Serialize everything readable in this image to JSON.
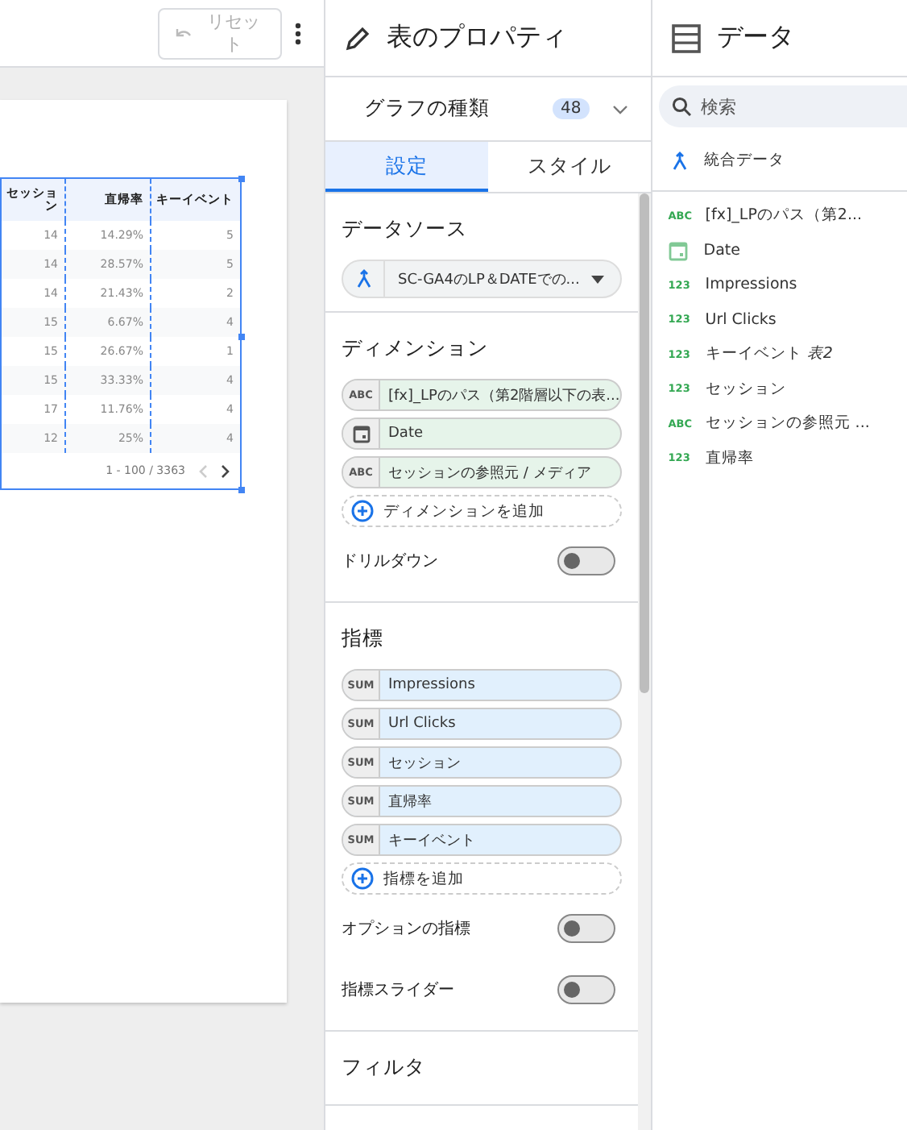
{
  "toolbar": {
    "reset_label": "リセット"
  },
  "table": {
    "columns": [
      "セッション",
      "直帰率",
      "キーイベント"
    ],
    "rows": [
      [
        "14",
        "14.29%",
        "5"
      ],
      [
        "14",
        "28.57%",
        "5"
      ],
      [
        "14",
        "21.43%",
        "2"
      ],
      [
        "15",
        "6.67%",
        "4"
      ],
      [
        "15",
        "26.67%",
        "1"
      ],
      [
        "15",
        "33.33%",
        "4"
      ],
      [
        "17",
        "11.76%",
        "4"
      ],
      [
        "12",
        "25%",
        "4"
      ]
    ],
    "pagination": "1 - 100 / 3363",
    "prev_disabled": true,
    "next_disabled": false
  },
  "properties": {
    "title": "表のプロパティ",
    "chart_type_label": "グラフの種類",
    "chart_type_count": "48",
    "tabs": [
      {
        "label": "設定",
        "selected": true
      },
      {
        "label": "スタイル",
        "selected": false
      }
    ],
    "data_source": {
      "title": "データソース",
      "value": "SC-GA4のLP＆DATEでの..."
    },
    "dimensions": {
      "title": "ディメンション",
      "items": [
        {
          "kind": "text",
          "badge": "ABC",
          "label": "[fx]_LPのパス（第2階層以下の表..."
        },
        {
          "kind": "date",
          "label": "Date"
        },
        {
          "kind": "text",
          "badge": "ABC",
          "label": "セッションの参照元 / メディア"
        }
      ],
      "add_label": "ディメンションを追加"
    },
    "drilldown": {
      "label": "ドリルダウン",
      "on": false
    },
    "metrics": {
      "title": "指標",
      "items": [
        {
          "badge": "SUM",
          "label": "Impressions"
        },
        {
          "badge": "SUM",
          "label": "Url Clicks"
        },
        {
          "badge": "SUM",
          "label": "セッション"
        },
        {
          "badge": "SUM",
          "label": "直帰率"
        },
        {
          "badge": "SUM",
          "label": "キーイベント"
        }
      ],
      "add_label": "指標を追加"
    },
    "metric_toggles": [
      {
        "label": "オプションの指標",
        "on": false
      },
      {
        "label": "指標スライダー",
        "on": false
      }
    ],
    "filter": {
      "title": "フィルタ"
    }
  },
  "data_panel": {
    "title": "データ",
    "search": {
      "placeholder": "検索"
    },
    "source": "統合データ",
    "fields": [
      {
        "kind": "text",
        "badge": "ABC",
        "label": "[fx]_LPのパス（第2..."
      },
      {
        "kind": "date",
        "label": "Date"
      },
      {
        "kind": "number",
        "badge": "123",
        "label": "Impressions"
      },
      {
        "kind": "number",
        "badge": "123",
        "label": "Url Clicks"
      },
      {
        "kind": "number",
        "badge": "123",
        "label": "キーイベント *表2*"
      },
      {
        "kind": "number",
        "badge": "123",
        "label": "セッション"
      },
      {
        "kind": "text",
        "badge": "ABC",
        "label": "セッションの参照元 ..."
      },
      {
        "kind": "number",
        "badge": "123",
        "label": "直帰率"
      }
    ]
  }
}
